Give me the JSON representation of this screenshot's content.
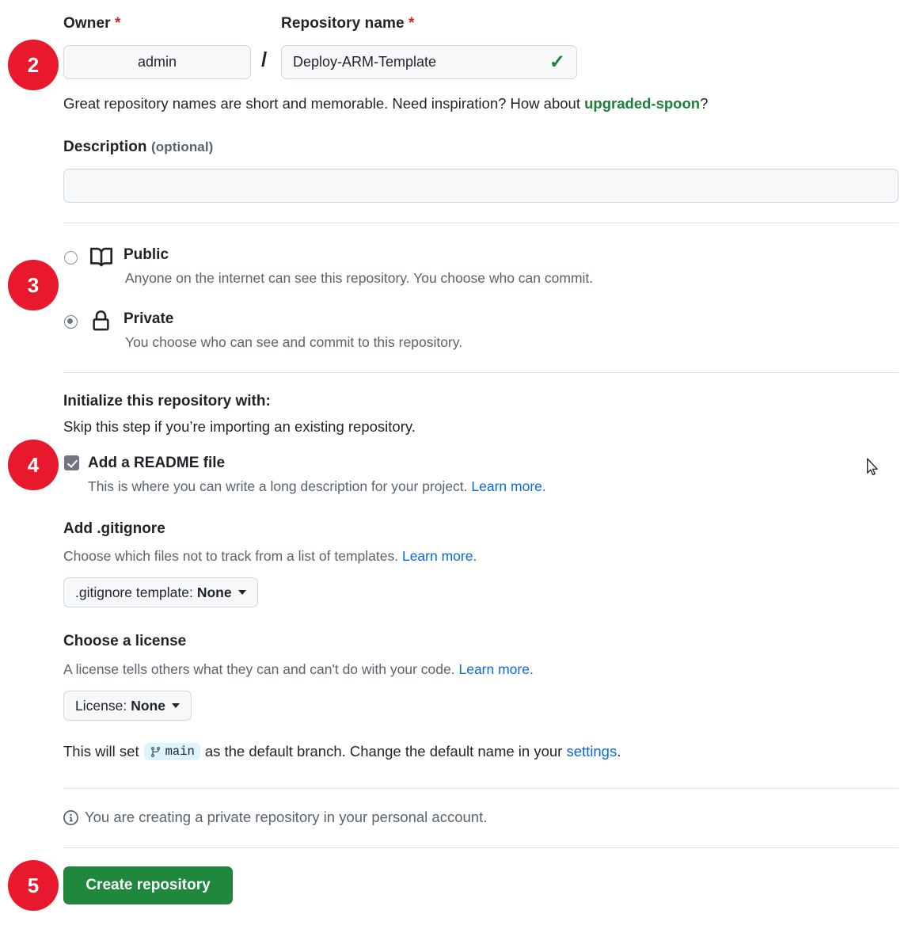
{
  "form": {
    "owner": {
      "label": "Owner",
      "required_mark": "*",
      "value": "admin"
    },
    "separator": "/",
    "repository_name": {
      "label": "Repository name",
      "required_mark": "*",
      "value": "Deploy-ARM-Template",
      "valid_icon": "check-icon"
    },
    "name_hint": {
      "text_before": "Great repository names are short and memorable. Need inspiration? How about ",
      "suggestion": "upgraded-spoon",
      "text_after": "?"
    },
    "description": {
      "label": "Description",
      "optional": "(optional)",
      "value": "",
      "placeholder": ""
    }
  },
  "visibility": {
    "options": [
      {
        "id": "public",
        "title": "Public",
        "description": "Anyone on the internet can see this repository. You choose who can commit.",
        "icon": "book-icon",
        "selected": false
      },
      {
        "id": "private",
        "title": "Private",
        "description": "You choose who can see and commit to this repository.",
        "icon": "lock-icon",
        "selected": true
      }
    ]
  },
  "initialize": {
    "heading": "Initialize this repository with:",
    "subheading": "Skip this step if you’re importing an existing repository.",
    "readme": {
      "label": "Add a README file",
      "checked": true,
      "description": "This is where you can write a long description for your project.",
      "link": "Learn more."
    },
    "gitignore": {
      "heading": "Add .gitignore",
      "description": "Choose which files not to track from a list of templates.",
      "link": "Learn more.",
      "dropdown_prefix": ".gitignore template:",
      "dropdown_value": "None"
    },
    "license": {
      "heading": "Choose a license",
      "description": "A license tells others what they can and can't do with your code.",
      "link": "Learn more.",
      "dropdown_prefix": "License:",
      "dropdown_value": "None"
    }
  },
  "branch_note": {
    "text_before": "This will set",
    "branch_name": "main",
    "branch_icon": "git-branch-icon",
    "text_middle": "as the default branch. Change the default name in your",
    "link": "settings",
    "text_after": "."
  },
  "account_note": {
    "icon": "info-icon",
    "text": "You are creating a private repository in your personal account."
  },
  "actions": {
    "create_label": "Create repository"
  },
  "annotations": [
    {
      "number": "2",
      "target": "owner-and-repo-name"
    },
    {
      "number": "3",
      "target": "visibility-options"
    },
    {
      "number": "4",
      "target": "add-readme-checkbox"
    },
    {
      "number": "5",
      "target": "create-repository-button"
    }
  ],
  "colors": {
    "badge_red": "#e8192c",
    "primary_green": "#1f883d",
    "link_blue": "#0969da",
    "suggestion_green": "#1a7f37",
    "required_red": "#cf222e",
    "branch_badge_bg": "#ddf4ff"
  }
}
